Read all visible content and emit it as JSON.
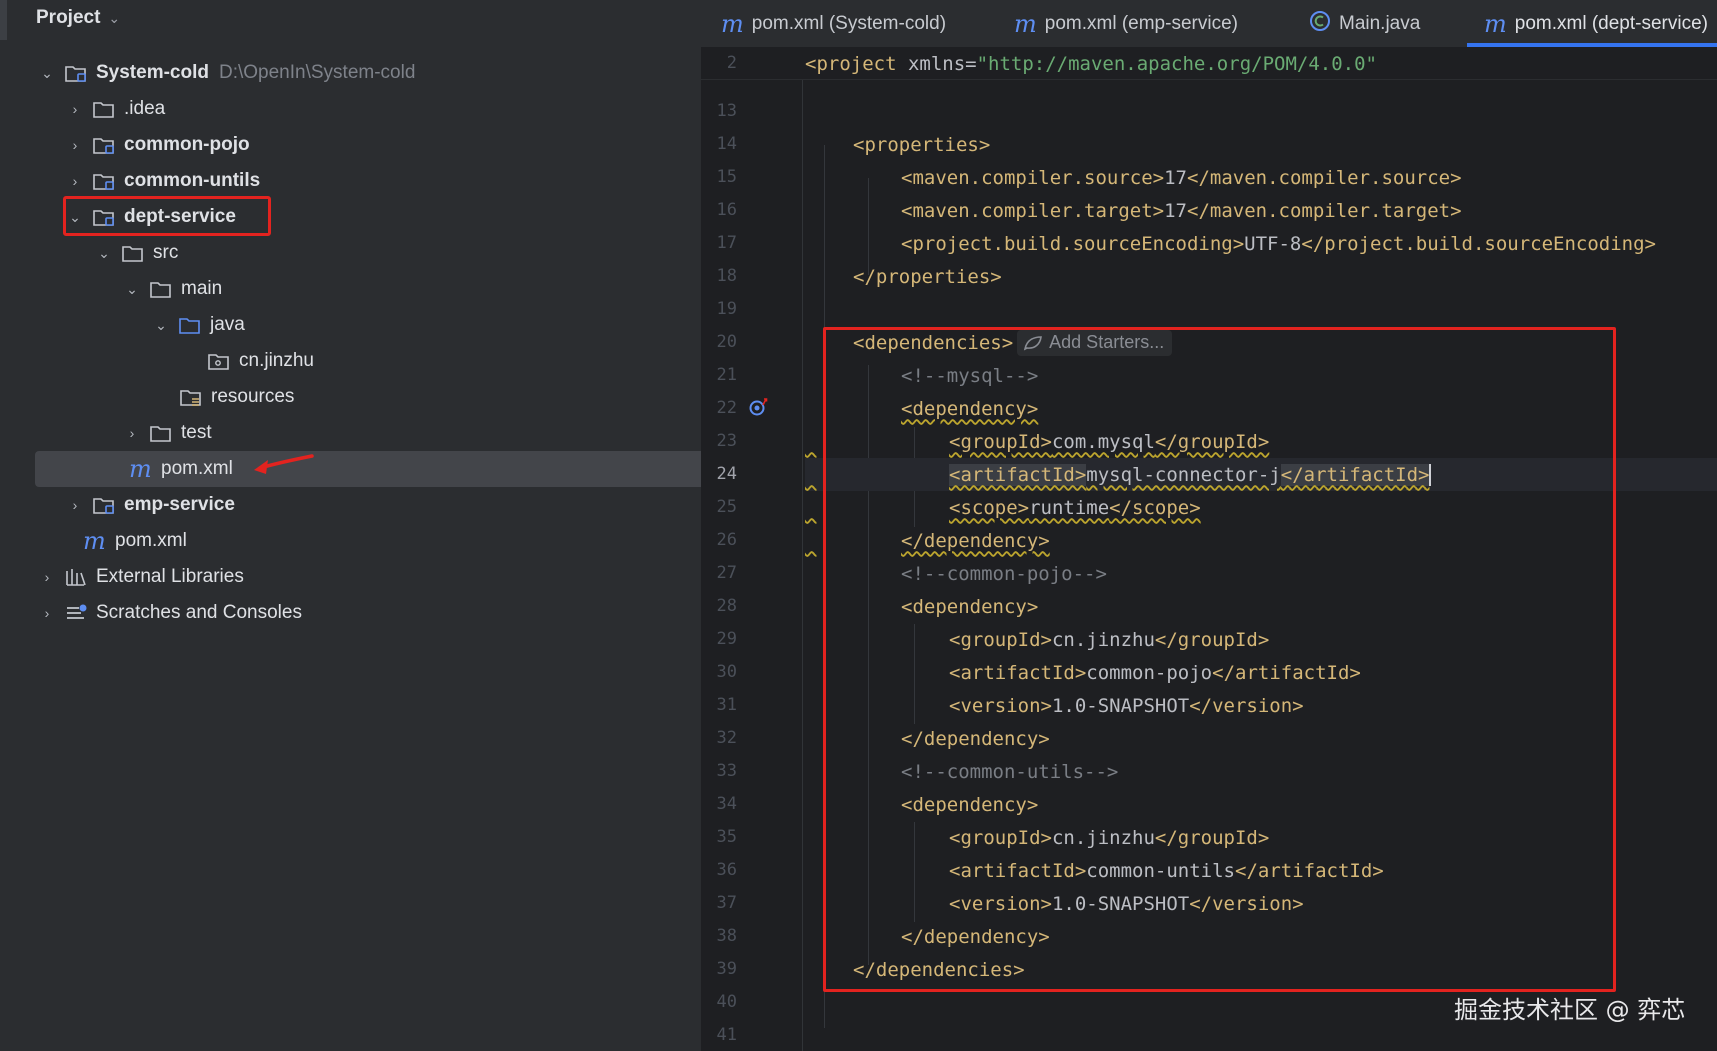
{
  "project_panel": {
    "title": "Project",
    "root": {
      "name": "System-cold",
      "path": "D:\\OpenIn\\System-cold"
    },
    "items": [
      {
        "name": ".idea",
        "arrow": "›"
      },
      {
        "name": "common-pojo",
        "arrow": "›"
      },
      {
        "name": "common-untils",
        "arrow": "›"
      },
      {
        "name": "dept-service",
        "arrow": "⌄"
      },
      {
        "name": "src",
        "arrow": "⌄"
      },
      {
        "name": "main",
        "arrow": "⌄"
      },
      {
        "name": "java",
        "arrow": "⌄"
      },
      {
        "name": "cn.jinzhu",
        "arrow": ""
      },
      {
        "name": "resources",
        "arrow": ""
      },
      {
        "name": "test",
        "arrow": "›"
      },
      {
        "name": "pom.xml",
        "arrow": ""
      },
      {
        "name": "emp-service",
        "arrow": "›"
      },
      {
        "name": "pom.xml",
        "arrow": ""
      },
      {
        "name": "External Libraries",
        "arrow": "›"
      },
      {
        "name": "Scratches and Consoles",
        "arrow": "›"
      }
    ]
  },
  "tabs": [
    {
      "label": "pom.xml (System-cold)",
      "icon": "maven-icon"
    },
    {
      "label": "pom.xml (emp-service)",
      "icon": "maven-icon"
    },
    {
      "label": "Main.java",
      "icon": "java-class-icon"
    },
    {
      "label": "pom.xml (dept-service)",
      "icon": "maven-icon",
      "active": true
    }
  ],
  "editor": {
    "sticky": {
      "line_number": "2",
      "tag_open": "<project",
      "attr": " xmlns=",
      "value": "\"http://maven.apache.org/POM/4.0.0\""
    },
    "line_numbers": [
      "13",
      "14",
      "15",
      "16",
      "17",
      "18",
      "19",
      "20",
      "21",
      "22",
      "23",
      "24",
      "25",
      "26",
      "27",
      "28",
      "29",
      "30",
      "31",
      "32",
      "33",
      "34",
      "35",
      "36",
      "37",
      "38",
      "39",
      "40",
      "41"
    ],
    "current_line": "24",
    "inlay_hint": "Add Starters...",
    "lines": {
      "l14": "<properties>",
      "l15_open": "<maven.compiler.source>",
      "l15_val": "17",
      "l15_close": "</maven.compiler.source>",
      "l16_open": "<maven.compiler.target>",
      "l16_val": "17",
      "l16_close": "</maven.compiler.target>",
      "l17_open": "<project.build.sourceEncoding>",
      "l17_val": "UTF-8",
      "l17_close": "</project.build.sourceEncoding>",
      "l18": "</properties>",
      "l20": "<dependencies>",
      "l21": "<!--mysql-->",
      "l22": "<dependency>",
      "l23_open": "<groupId>",
      "l23_val": "com.mysql",
      "l23_close": "</groupId>",
      "l24_open": "<artifactId>",
      "l24_val": "mysql-connector-j",
      "l24_close": "</artifactId>",
      "l25_open": "<scope>",
      "l25_val": "runtime",
      "l25_close": "</scope>",
      "l26": "</dependency>",
      "l27": "<!--common-pojo-->",
      "l28": "<dependency>",
      "l29_open": "<groupId>",
      "l29_val": "cn.jinzhu",
      "l29_close": "</groupId>",
      "l30_open": "<artifactId>",
      "l30_val": "common-pojo",
      "l30_close": "</artifactId>",
      "l31_open": "<version>",
      "l31_val": "1.0-SNAPSHOT",
      "l31_close": "</version>",
      "l32": "</dependency>",
      "l33": "<!--common-utils-->",
      "l34": "<dependency>",
      "l35_open": "<groupId>",
      "l35_val": "cn.jinzhu",
      "l35_close": "</groupId>",
      "l36_open": "<artifactId>",
      "l36_val": "common-untils",
      "l36_close": "</artifactId>",
      "l37_open": "<version>",
      "l37_val": "1.0-SNAPSHOT",
      "l37_close": "</version>",
      "l38": "</dependency>",
      "l39": "</dependencies>"
    }
  },
  "watermark": "掘金技术社区 @ 弈芯",
  "colors": {
    "annotation_red": "#e3231f",
    "tab_accent": "#3574f0",
    "xml_tag": "#d5b778",
    "xml_string": "#6aab73",
    "comment": "#7a7e85"
  }
}
